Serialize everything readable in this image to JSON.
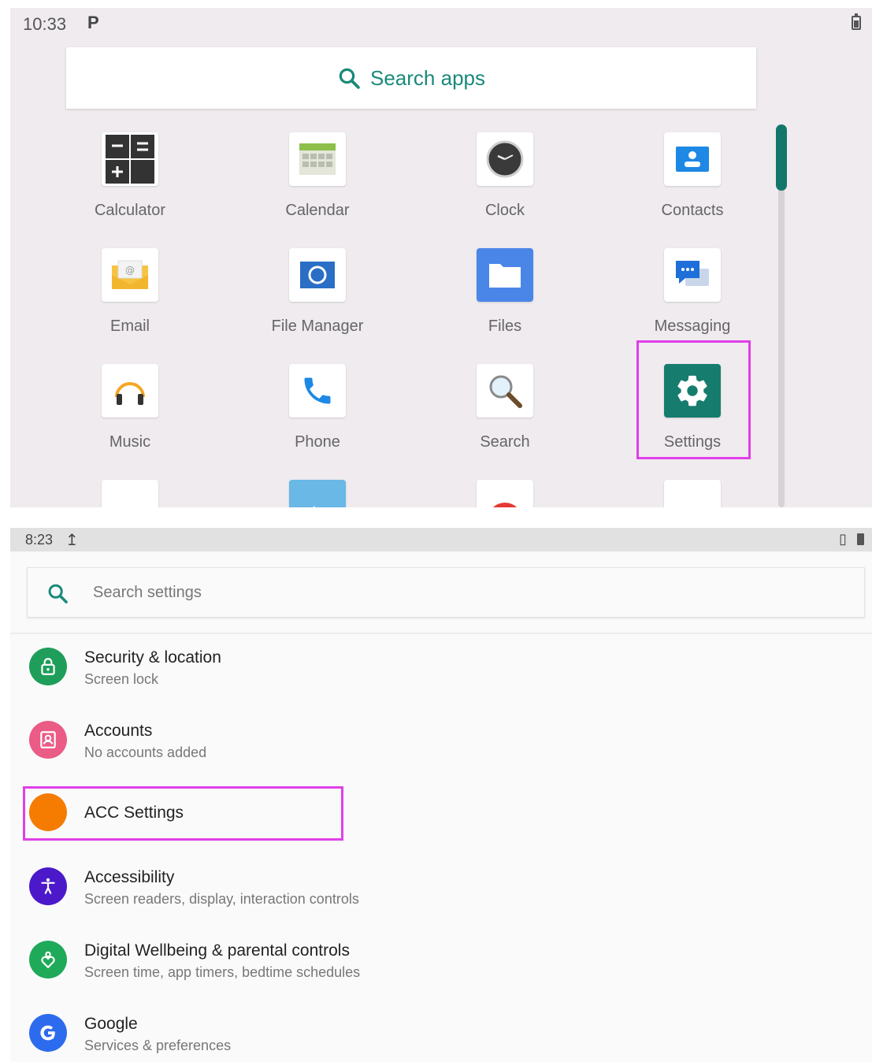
{
  "drawer": {
    "status": {
      "time": "10:33",
      "p_icon": "P"
    },
    "search_label": "Search apps",
    "apps": [
      {
        "name": "Calculator"
      },
      {
        "name": "Calendar"
      },
      {
        "name": "Clock"
      },
      {
        "name": "Contacts"
      },
      {
        "name": "Email"
      },
      {
        "name": "File Manager"
      },
      {
        "name": "Files"
      },
      {
        "name": "Messaging"
      },
      {
        "name": "Music"
      },
      {
        "name": "Phone"
      },
      {
        "name": "Search"
      },
      {
        "name": "Settings"
      }
    ],
    "highlighted_app": "Settings",
    "accent_color": "#1a8a7a",
    "highlight_color": "#e040e8"
  },
  "settings": {
    "status": {
      "time": "8:23",
      "upload_icon": "↥",
      "vibrate_icon": "▯"
    },
    "search_placeholder": "Search settings",
    "items": [
      {
        "title": "Security & location",
        "subtitle": "Screen lock",
        "color": "#1e9e5a"
      },
      {
        "title": "Accounts",
        "subtitle": "No accounts added",
        "color": "#ea5b86"
      },
      {
        "title": "ACC Settings",
        "subtitle": "",
        "color": "#f57c00"
      },
      {
        "title": "Accessibility",
        "subtitle": "Screen readers, display, interaction controls",
        "color": "#4b19c9"
      },
      {
        "title": "Digital Wellbeing & parental controls",
        "subtitle": "Screen time, app timers, bedtime schedules",
        "color": "#1faa59"
      },
      {
        "title": "Google",
        "subtitle": "Services & preferences",
        "color": "#2c6bed"
      }
    ],
    "highlighted_item": "ACC Settings"
  }
}
